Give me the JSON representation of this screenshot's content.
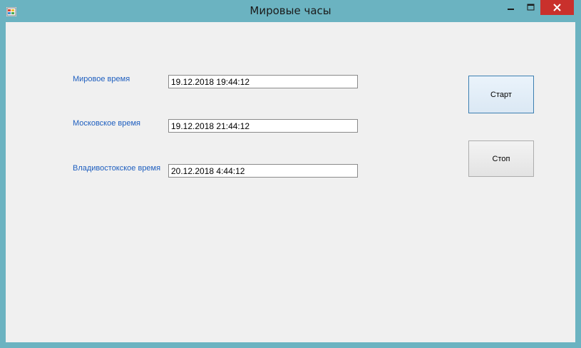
{
  "window": {
    "title": "Мировые часы",
    "controls": {
      "minimize": "minimize-icon",
      "maximize": "maximize-icon",
      "close": "close-icon"
    }
  },
  "fields": [
    {
      "label": "Мировое время",
      "value": "19.12.2018 19:44:12"
    },
    {
      "label": "Московское время",
      "value": "19.12.2018 21:44:12"
    },
    {
      "label": "Владивостокское время",
      "value": "20.12.2018 4:44:12"
    }
  ],
  "buttons": {
    "start_label": "Старт",
    "stop_label": "Стоп"
  },
  "colors": {
    "titlebar": "#6bb3c1",
    "close": "#c9302c",
    "label": "#1f5fbf",
    "client": "#f0f0f0"
  }
}
